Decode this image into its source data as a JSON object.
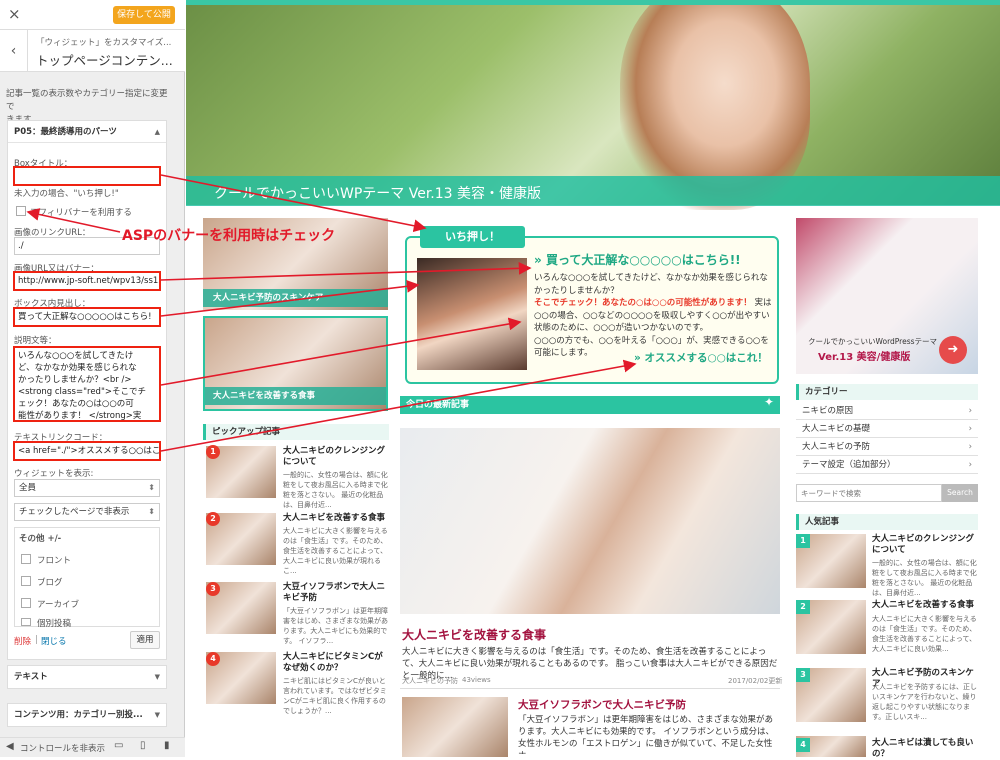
{
  "customizer": {
    "close_icon": "×",
    "save_label": "保存して公開",
    "breadcrumb": "「ウィジェット」をカスタマイズ...",
    "page_title": "トップページコンテン...",
    "description_lines": [
      "記事一覧の表示数やカテゴリー指定に変更で",
      "きます"
    ],
    "widget_title": "P05：最終誘導用のパーツ",
    "box_title_label": "Boxタイトル：",
    "box_title_value": "",
    "box_title_note": "未入力の場合、\"いち押し!\"",
    "affiliate_checkbox_label": "アフィリバナーを利用する",
    "image_link_label": "画像のリンクURL：",
    "image_link_value": "./",
    "image_url_label": "画像URL又はバナー：",
    "image_url_value": "http://www.jp-soft.net/wpv13/ss13",
    "box_heading_label": "ボックス内見出し：",
    "box_heading_value": "買って大正解な○○○○○はこちら!",
    "explanation_label": "説明文等：",
    "explanation_lines": [
      "いろんな○○○を試してきたけ",
      "ど、なかなか効果を感じられな",
      "かったりしませんか？<br />",
      "<strong class=\"red\">そこでチ",
      "ェック！あなたの○は○○の可",
      "能性があります！ </strong>実"
    ],
    "textlink_label": "テキストリンクコード：",
    "textlink_value": "<a href=\"./\">オススメする○○はこ",
    "show_widget_label": "ウィジェットを表示:",
    "show_widget_value": "全員",
    "page_visibility_value": "チェックしたページで非表示",
    "other_label": "その他 +/-",
    "visibility_items": [
      "フロント",
      "ブログ",
      "アーカイブ",
      "個別投稿"
    ],
    "delete_link": "削除",
    "close_link": "閉じる",
    "apply_button": "適用",
    "panel_text": "テキスト",
    "panel_contents": "コンテンツ用：カテゴリー別投...",
    "hide_controls": "コントロールを非表示"
  },
  "annotation": {
    "callout_text": "ASPのバナーを利用時はチェック",
    "color": "#e21a2a"
  },
  "site": {
    "hero_title": "クールでかっこいいWPテーマ Ver.13 美容・健康版",
    "left_cards": [
      {
        "label": "大人ニキビ予防のスキンケア"
      },
      {
        "label": "大人ニキビを改善する食事"
      }
    ],
    "banner": {
      "ribbon": "いち押し！",
      "heading": "買って大正解な○○○○○はこちら!!",
      "line1": "いろんな○○○を試してきたけど、なかなか効果を感じられなかったりしませんか？",
      "red": "そこでチェック！あなたの○は○○の可能性があります！",
      "line2": "実は○○の場合、○○などの○○○○を吸収しやすく○○が出やすい状態のために、○○○が造いつかないのです。",
      "line3": "○○○の方でも、○○を叶える「○○○」が、実感できる○○を可能にします。",
      "link": "オススメする○○はこれ！"
    },
    "pickup_heading": "ピックアップ記事",
    "pickup_items": [
      {
        "num": "1",
        "title": "大人ニキビのクレンジングについて",
        "excerpt": "一般的に、女性の場合は、額に化粧をして夜お風呂に入る時まで化粧を落とさない。 最近の化粧品は、目鼻付近..."
      },
      {
        "num": "2",
        "title": "大人ニキビを改善する食事",
        "excerpt": "大人ニキビに大きく影響を与えるのは「食生活」です。そのため、食生活を改善することによって、大人ニキビに良い効果が現れるこ..."
      },
      {
        "num": "3",
        "title": "大豆イソフラボンで大人ニキビ予防",
        "excerpt": "「大豆イソフラボン」は更年期障害をはじめ、さまざまな効果があります。大人ニキビにも効果的です。 イソフラ..."
      },
      {
        "num": "4",
        "title": "大人ニキビにビタミンCがなぜ効くのか？",
        "excerpt": "ニキビ肌にはビタミンCが良いと言われています。ではなぜビタミンCがニキビ肌に良く作用するのでしょうか？..."
      }
    ],
    "latest_heading": "今日の最新記事",
    "feature_title": "大人ニキビを改善する食事",
    "feature_excerpt": "大人ニキビに大きく影響を与えるのは「食生活」です。そのため、食生活を改善することによって、大人ニキビに良い効果が現れることもあるのです。 脂っこい食事は大人ニキビができる原因だと一般的に...",
    "feature_category": "大人ニキビの予防",
    "feature_views": "43views",
    "feature_date": "2017/02/02更新",
    "second_title": "大豆イソフラボンで大人ニキビ予防",
    "second_excerpt": "「大豆イソフラボン」は更年期障害をはじめ、さまざまな効果があります。大人ニキビにも効果的です。 イソフラボンという成分は、女性ホルモンの「エストロゲン」に働きが似ていて、不足した女性ホ...",
    "side_banner_text1": "クールでかっこいいWordPressテーマ",
    "side_banner_text2": "Ver.13 美容/健康版",
    "category_heading": "カテゴリー",
    "categories": [
      "ニキビの原因",
      "大人ニキビの基礎",
      "大人ニキビの予防",
      "テーマ設定（追加部分）"
    ],
    "search_placeholder": "キーワードで検索",
    "search_button": "Search",
    "popular_heading": "人気記事",
    "popular_items": [
      {
        "num": "1",
        "title": "大人ニキビのクレンジングについて",
        "excerpt": "一般的に、女性の場合は、額に化粧をして夜お風呂に入る時まで化粧を落とさない。 最近の化粧品は、目鼻付近..."
      },
      {
        "num": "2",
        "title": "大人ニキビを改善する食事",
        "excerpt": "大人ニキビに大きく影響を与えるのは「食生活」です。そのため、食生活を改善することによって、大人ニキビに良い効果..."
      },
      {
        "num": "3",
        "title": "大人ニキビ予防のスキンケア",
        "excerpt": "大人ニキビを予防するには、正しいスキンケアを行わないと、繰り返し起こりやすい状態になります。正しいスキ..."
      },
      {
        "num": "4",
        "title": "大人ニキビは潰しても良いの？",
        "excerpt": ""
      }
    ]
  }
}
